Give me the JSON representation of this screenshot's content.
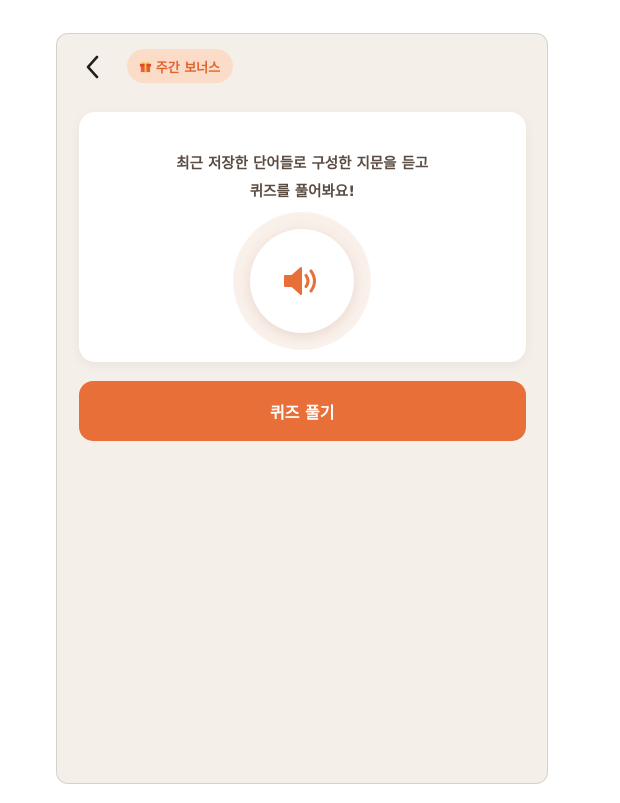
{
  "header": {
    "back_icon": "chevron-left-icon",
    "badge": {
      "icon": "gift-icon",
      "label": "주간 보너스"
    }
  },
  "card": {
    "description_line1": "최근 저장한 단어들로 구성한 지문을 듣고",
    "description_line2": "퀴즈를 풀어봐요!",
    "speaker_icon": "speaker-icon"
  },
  "quiz_button": {
    "label": "퀴즈 풀기"
  },
  "colors": {
    "accent": "#e86f38",
    "badge_bg": "#fadcc9",
    "badge_text": "#e0632e",
    "background": "#f4efe9",
    "card": "#ffffff",
    "text": "#5a4c42"
  }
}
